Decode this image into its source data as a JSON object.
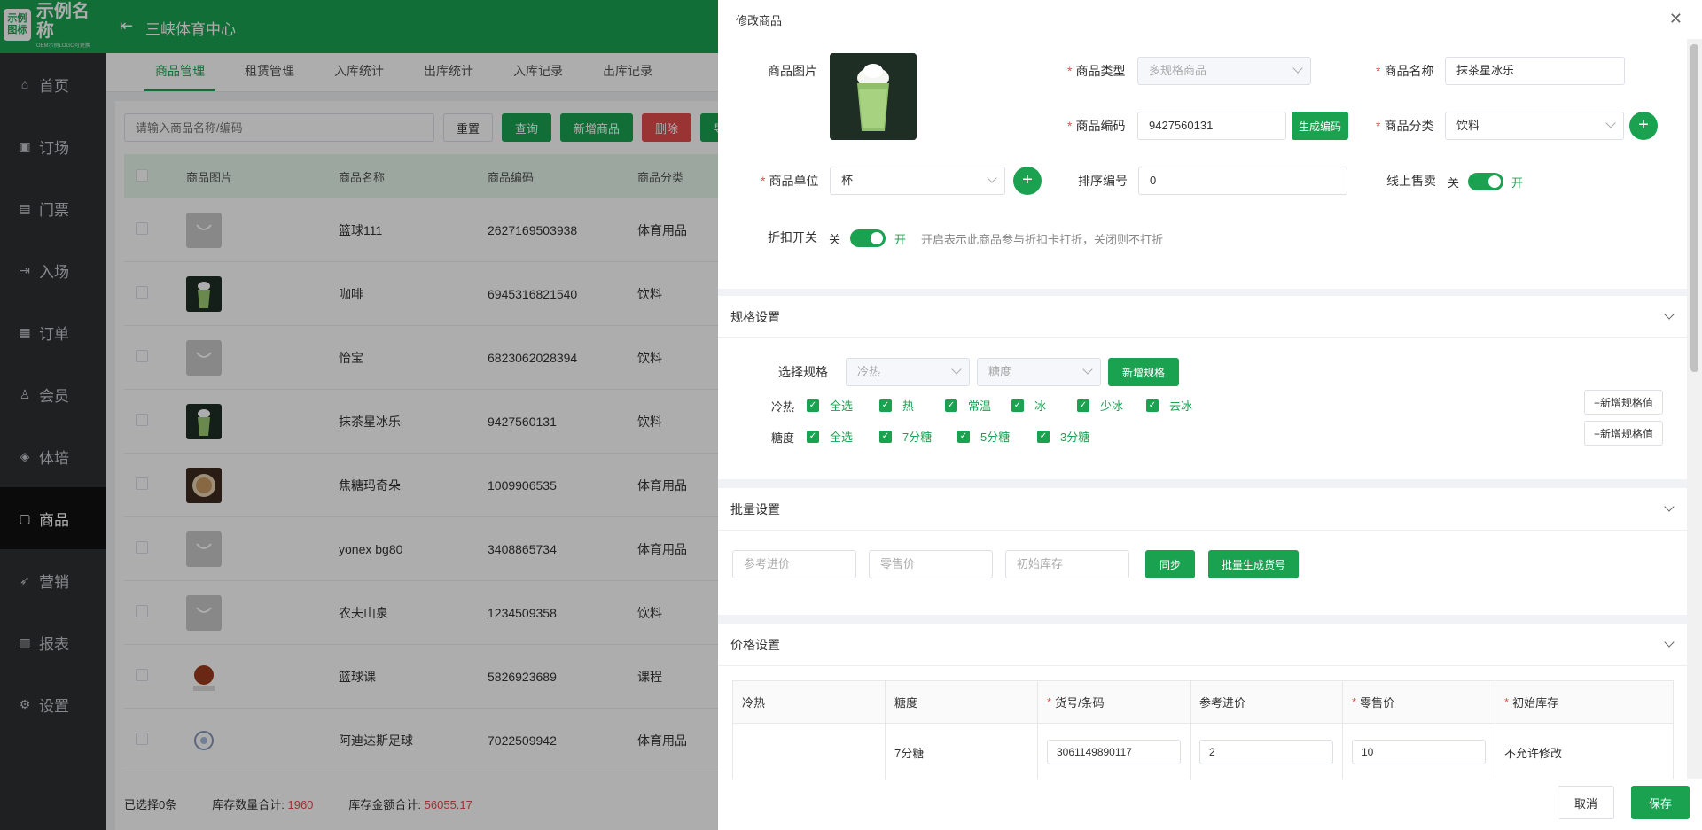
{
  "app": {
    "logo_mark_line1": "示例",
    "logo_mark_line2": "图标",
    "logo_name": "示例名称",
    "logo_sub": "OEM示例LOGO可更换",
    "venue": "三峡体育中心"
  },
  "sidebar": {
    "items": [
      {
        "label": "首页",
        "icon": "home-icon",
        "glyph": "⌂"
      },
      {
        "label": "订场",
        "icon": "court-icon",
        "glyph": "▣"
      },
      {
        "label": "门票",
        "icon": "ticket-icon",
        "glyph": "▤"
      },
      {
        "label": "入场",
        "icon": "enter-icon",
        "glyph": "⇥"
      },
      {
        "label": "订单",
        "icon": "order-icon",
        "glyph": "▦"
      },
      {
        "label": "会员",
        "icon": "member-icon",
        "glyph": "♙"
      },
      {
        "label": "体培",
        "icon": "training-icon",
        "glyph": "◈"
      },
      {
        "label": "商品",
        "icon": "goods-icon",
        "glyph": "▢"
      },
      {
        "label": "营销",
        "icon": "marketing-icon",
        "glyph": "➶"
      },
      {
        "label": "报表",
        "icon": "report-icon",
        "glyph": "▥"
      },
      {
        "label": "设置",
        "icon": "settings-icon",
        "glyph": "⚙"
      }
    ],
    "active": 7
  },
  "tabs": [
    "商品管理",
    "租赁管理",
    "入库统计",
    "出库统计",
    "入库记录",
    "出库记录"
  ],
  "toolbar": {
    "search_placeholder": "请输入商品名称/编码",
    "reset": "重置",
    "query": "查询",
    "add": "新增商品",
    "delete": "删除",
    "extra": "导"
  },
  "table": {
    "columns": [
      "商品图片",
      "商品名称",
      "商品编码",
      "商品分类"
    ],
    "rows": [
      {
        "img": "bag",
        "name": "篮球111",
        "code": "2627169503938",
        "cat": "体育用品"
      },
      {
        "img": "drink",
        "name": "咖啡",
        "code": "6945316821540",
        "cat": "饮料"
      },
      {
        "img": "bag",
        "name": "怡宝",
        "code": "6823062028394",
        "cat": "饮料"
      },
      {
        "img": "drink",
        "name": "抹茶星冰乐",
        "code": "9427560131",
        "cat": "饮料"
      },
      {
        "img": "coffee",
        "name": "焦糖玛奇朵",
        "code": "1009906535",
        "cat": "体育用品"
      },
      {
        "img": "bag",
        "name": "yonex bg80",
        "code": "3408865734",
        "cat": "体育用品"
      },
      {
        "img": "bag",
        "name": "农夫山泉",
        "code": "1234509358",
        "cat": "饮料"
      },
      {
        "img": "lesson",
        "name": "篮球课",
        "code": "5826923689",
        "cat": "课程"
      },
      {
        "img": "ball",
        "name": "阿迪达斯足球",
        "code": "7022509942",
        "cat": "体育用品"
      }
    ]
  },
  "footer": {
    "selected": "已选择0条",
    "stock_qty_label": "库存数量合计:",
    "stock_qty": "1960",
    "stock_amt_label": "库存金额合计:",
    "stock_amt": "56055.17"
  },
  "drawer": {
    "title": "修改商品",
    "image_label": "商品图片",
    "type_label": "商品类型",
    "type_value": "多规格商品",
    "name_label": "商品名称",
    "name_value": "抹茶星冰乐",
    "code_label": "商品编码",
    "code_value": "9427560131",
    "gen_code": "生成编码",
    "cat_label": "商品分类",
    "cat_value": "饮料",
    "unit_label": "商品单位",
    "unit_value": "杯",
    "sort_label": "排序编号",
    "sort_value": "0",
    "online_label": "线上售卖",
    "off": "关",
    "on": "开",
    "discount_label": "折扣开关",
    "discount_hint": "开启表示此商品参与折扣卡打折，关闭则不打折",
    "spec": {
      "title": "规格设置",
      "select_label": "选择规格",
      "sel1": "冷热",
      "sel2": "糖度",
      "add": "新增规格",
      "groups": [
        {
          "name": "冷热",
          "options": [
            "全选",
            "热",
            "常温",
            "冰",
            "少冰",
            "去冰"
          ]
        },
        {
          "name": "糖度",
          "options": [
            "全选",
            "7分糖",
            "5分糖",
            "3分糖"
          ]
        }
      ],
      "add_value": "+新增规格值"
    },
    "batch": {
      "title": "批量设置",
      "p1": "参考进价",
      "p2": "零售价",
      "p3": "初始库存",
      "sync": "同步",
      "gen": "批量生成货号"
    },
    "price": {
      "title": "价格设置",
      "cols": [
        "冷热",
        "糖度",
        "货号/条码",
        "参考进价",
        "零售价",
        "初始库存"
      ],
      "row": {
        "c1": "",
        "c2": "7分糖",
        "c3": "3061149890117",
        "c4": "2",
        "c5": "10",
        "c6": "不允许修改"
      }
    },
    "cancel": "取消",
    "save": "保存"
  }
}
